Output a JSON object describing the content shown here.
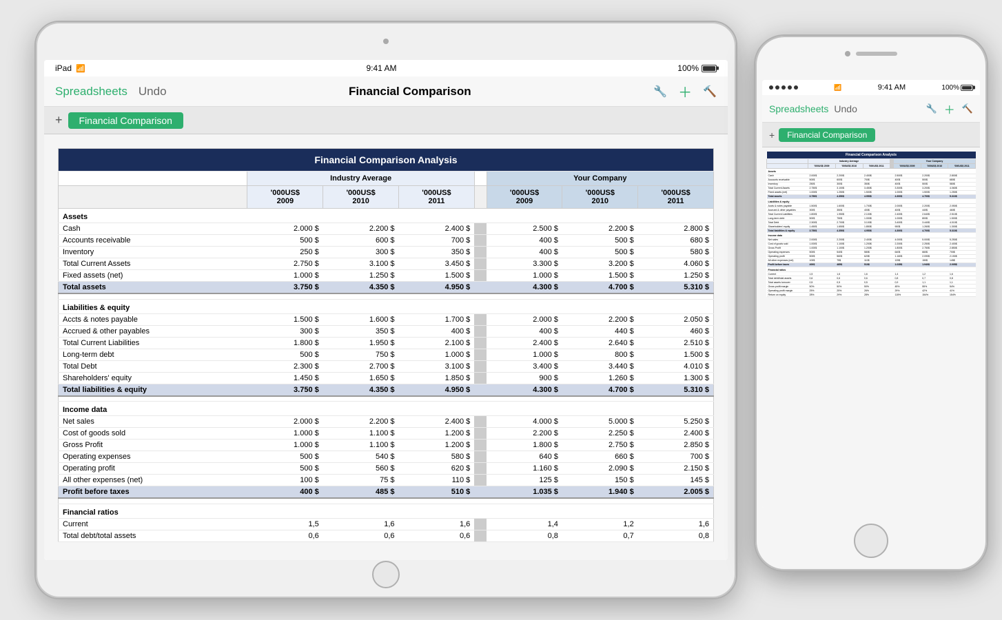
{
  "ipad": {
    "status": {
      "device": "iPad",
      "wifi": "WiFi",
      "time": "9:41 AM",
      "battery": "100%"
    },
    "toolbar": {
      "spreadsheets_label": "Spreadsheets",
      "undo_label": "Undo",
      "title": "Financial Comparison"
    },
    "tab": {
      "label": "Financial Comparison"
    }
  },
  "iphone": {
    "status": {
      "signal_dots": 5,
      "wifi": "WiFi",
      "time": "9:41 AM",
      "battery": "100%"
    },
    "toolbar": {
      "spreadsheets_label": "Spreadsheets",
      "undo_label": "Undo"
    },
    "tab": {
      "label": "Financial Comparison"
    }
  },
  "spreadsheet": {
    "title": "Financial Comparison Analysis",
    "industry_header": "Industry Average",
    "company_header": "Your Company",
    "col_headers": [
      "'000US$ 2009",
      "'000US$ 2010",
      "'000US$ 2011",
      "'000US$ 2009",
      "'000US$ 2010",
      "'000US$ 2011"
    ],
    "sections": [
      {
        "name": "Assets",
        "rows": [
          {
            "label": "Cash",
            "i2009": "2.000 $",
            "i2010": "2.200 $",
            "i2011": "2.400 $",
            "c2009": "2.500 $",
            "c2010": "2.200 $",
            "c2011": "2.800 $"
          },
          {
            "label": "Accounts receivable",
            "i2009": "500 $",
            "i2010": "600 $",
            "i2011": "700 $",
            "c2009": "400 $",
            "c2010": "500 $",
            "c2011": "680 $"
          },
          {
            "label": "Inventory",
            "i2009": "250 $",
            "i2010": "300 $",
            "i2011": "350 $",
            "c2009": "400 $",
            "c2010": "500 $",
            "c2011": "580 $"
          }
        ],
        "subtotals": [
          {
            "label": "Total Current Assets",
            "i2009": "2.750 $",
            "i2010": "3.100 $",
            "i2011": "3.450 $",
            "c2009": "3.300 $",
            "c2010": "3.200 $",
            "c2011": "4.060 $"
          },
          {
            "label": "Fixed assets (net)",
            "i2009": "1.000 $",
            "i2010": "1.250 $",
            "i2011": "1.500 $",
            "c2009": "1.000 $",
            "c2010": "1.500 $",
            "c2011": "1.250 $"
          }
        ],
        "total": {
          "label": "Total assets",
          "i2009": "3.750 $",
          "i2010": "4.350 $",
          "i2011": "4.950 $",
          "c2009": "4.300 $",
          "c2010": "4.700 $",
          "c2011": "5.310 $"
        }
      },
      {
        "name": "Liabilities & equity",
        "rows": [
          {
            "label": "Accts & notes payable",
            "i2009": "1.500 $",
            "i2010": "1.600 $",
            "i2011": "1.700 $",
            "c2009": "2.000 $",
            "c2010": "2.200 $",
            "c2011": "2.050 $"
          },
          {
            "label": "Accrued & other payables",
            "i2009": "300 $",
            "i2010": "350 $",
            "i2011": "400 $",
            "c2009": "400 $",
            "c2010": "440 $",
            "c2011": "460 $"
          }
        ],
        "subtotals": [
          {
            "label": "Total Current Liabilities",
            "i2009": "1.800 $",
            "i2010": "1.950 $",
            "i2011": "2.100 $",
            "c2009": "2.400 $",
            "c2010": "2.640 $",
            "c2011": "2.510 $"
          },
          {
            "label": "Long-term debt",
            "i2009": "500 $",
            "i2010": "750 $",
            "i2011": "1.000 $",
            "c2009": "1.000 $",
            "c2010": "800 $",
            "c2011": "1.500 $"
          },
          {
            "label": "Total Debt",
            "i2009": "2.300 $",
            "i2010": "2.700 $",
            "i2011": "3.100 $",
            "c2009": "3.400 $",
            "c2010": "3.440 $",
            "c2011": "4.010 $"
          },
          {
            "label": "Shareholders' equity",
            "i2009": "1.450 $",
            "i2010": "1.650 $",
            "i2011": "1.850 $",
            "c2009": "900 $",
            "c2010": "1.260 $",
            "c2011": "1.300 $"
          }
        ],
        "total": {
          "label": "Total liabilities & equity",
          "i2009": "3.750 $",
          "i2010": "4.350 $",
          "i2011": "4.950 $",
          "c2009": "4.300 $",
          "c2010": "4.700 $",
          "c2011": "5.310 $"
        }
      },
      {
        "name": "Income data",
        "rows": [
          {
            "label": "Net sales",
            "i2009": "2.000 $",
            "i2010": "2.200 $",
            "i2011": "2.400 $",
            "c2009": "4.000 $",
            "c2010": "5.000 $",
            "c2011": "5.250 $"
          },
          {
            "label": "Cost of goods sold",
            "i2009": "1.000 $",
            "i2010": "1.100 $",
            "i2011": "1.200 $",
            "c2009": "2.200 $",
            "c2010": "2.250 $",
            "c2011": "2.400 $"
          }
        ],
        "subtotals": [
          {
            "label": "Gross Profit",
            "i2009": "1.000 $",
            "i2010": "1.100 $",
            "i2011": "1.200 $",
            "c2009": "1.800 $",
            "c2010": "2.750 $",
            "c2011": "2.850 $"
          },
          {
            "label": "Operating expenses",
            "i2009": "500 $",
            "i2010": "540 $",
            "i2011": "580 $",
            "c2009": "640 $",
            "c2010": "660 $",
            "c2011": "700 $"
          },
          {
            "label": "Operating profit",
            "i2009": "500 $",
            "i2010": "560 $",
            "i2011": "620 $",
            "c2009": "1.160 $",
            "c2010": "2.090 $",
            "c2011": "2.150 $"
          },
          {
            "label": "All other expenses (net)",
            "i2009": "100 $",
            "i2010": "75 $",
            "i2011": "110 $",
            "c2009": "125 $",
            "c2010": "150 $",
            "c2011": "145 $"
          }
        ],
        "total": {
          "label": "Profit before taxes",
          "i2009": "400 $",
          "i2010": "485 $",
          "i2011": "510 $",
          "c2009": "1.035 $",
          "c2010": "1.940 $",
          "c2011": "2.005 $"
        }
      },
      {
        "name": "Financial ratios",
        "rows": [
          {
            "label": "Current",
            "i2009": "1,5",
            "i2010": "1,6",
            "i2011": "1,6",
            "c2009": "1,4",
            "c2010": "1,2",
            "c2011": "1,6"
          },
          {
            "label": "Total debt/total assets",
            "i2009": "0,6",
            "i2010": "0,6",
            "i2011": "0,6",
            "c2009": "0,8",
            "c2010": "0,7",
            "c2011": "0,8"
          }
        ]
      }
    ]
  }
}
